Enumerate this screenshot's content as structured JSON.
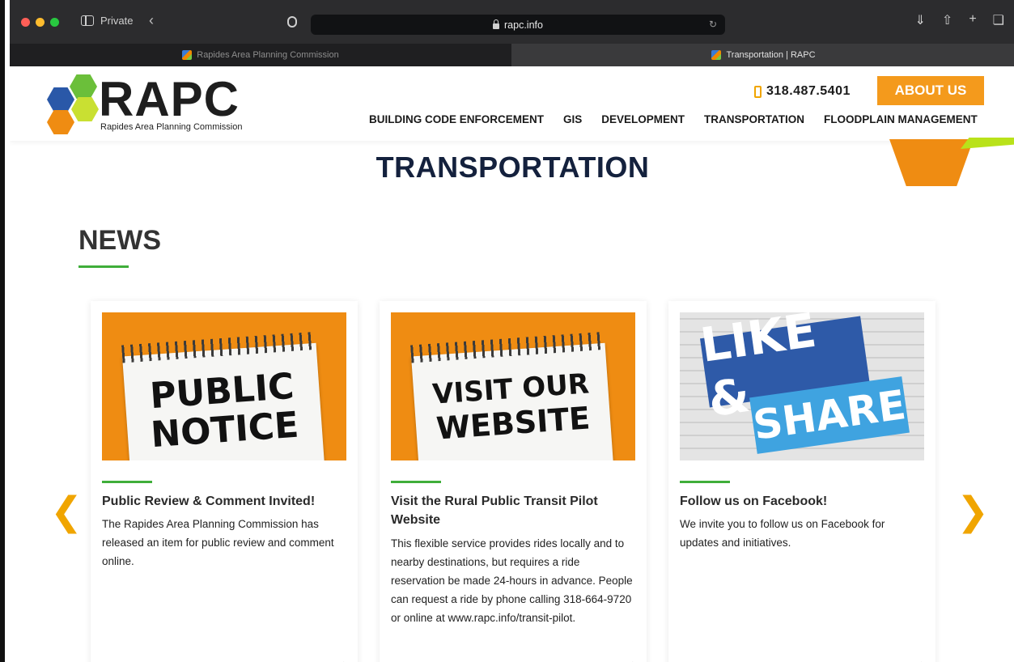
{
  "browser": {
    "private_label": "Private",
    "url": "rapc.info",
    "tabs": [
      {
        "title": "Rapides Area Planning Commission",
        "active": false
      },
      {
        "title": "Transportation | RAPC",
        "active": true
      }
    ]
  },
  "header": {
    "logo_text": "RAPC",
    "logo_subtitle": "Rapides Area Planning Commission",
    "phone": "318.487.5401",
    "about_label": "ABOUT US",
    "nav": [
      "BUILDING CODE ENFORCEMENT",
      "GIS",
      "DEVELOPMENT",
      "TRANSPORTATION",
      "FLOODPLAIN MANAGEMENT"
    ]
  },
  "page": {
    "title": "TRANSPORTATION",
    "news_heading": "NEWS"
  },
  "cards": [
    {
      "image_text_1": "PUBLIC",
      "image_text_2": "NOTICE",
      "title": "Public Review & Comment Invited!",
      "body": "The Rapides Area Planning Commission has released an item for public review and comment online."
    },
    {
      "image_text_1": "VISIT OUR",
      "image_text_2": "WEBSITE",
      "title": "Visit the Rural Public Transit Pilot Website",
      "body": "This flexible service provides rides locally and to nearby destinations, but requires a ride reservation be made 24-hours in advance. People can request a ride by phone calling 318-664-9720 or online at www.rapc.info/transit-pilot."
    },
    {
      "image_text_1": "LIKE &",
      "image_text_2": "SHARE",
      "title": "Follow us on Facebook!",
      "body": "We invite you to follow us on Facebook for updates and initiatives."
    }
  ],
  "colors": {
    "accent_orange": "#f49a1c",
    "accent_green": "#3fae3a",
    "title_navy": "#14213d"
  },
  "icons": [
    "sidebar-icon",
    "back-icon",
    "shield-icon",
    "lock-icon",
    "reload-icon",
    "download-icon",
    "share-icon",
    "new-tab-icon",
    "tabs-icon",
    "phone-icon",
    "chevron-left-icon",
    "chevron-right-icon"
  ]
}
